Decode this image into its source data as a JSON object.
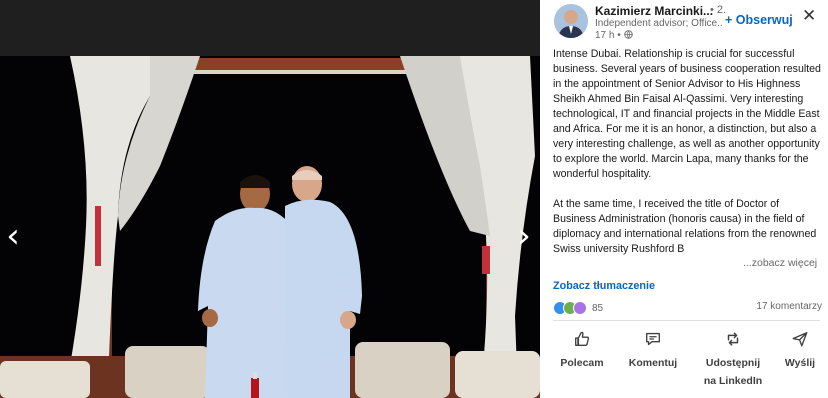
{
  "post": {
    "author": "Kazimierz Marcinki...",
    "degree": "• 2.",
    "subtitle": "Independent advisor; Office...",
    "time": "17 h •",
    "follow_label": "+ Obserwuj",
    "close_label": "✕",
    "body_p1": "Intense Dubai. Relationship is crucial for successful business. Several years of business cooperation resulted in the appointment of Senior Advisor to His Highness Sheikh Ahmed Bin Faisal Al-Qassimi. Very interesting technological, IT and financial projects in the Middle East and Africa. For me it is an honor, a distinction, but also a very interesting challenge, as well as another opportunity to explore the world. Marcin Lapa, many thanks for the wonderful hospitality.",
    "body_p2": "At the same time, I received the title of Doctor of Business Administration (honoris causa) in the field of diplomacy and international relations from the renowned Swiss university Rushford B",
    "see_more": "...zobacz więcej",
    "translate": "Zobacz tłumaczenie",
    "reactions_count": "85",
    "comments_count": "17 komentarzy"
  },
  "actions": {
    "like": "Polecam",
    "comment": "Komentuj",
    "share_line1": "Udostępnij",
    "share_line2": "na LinkedIn",
    "send": "Wyślij"
  },
  "viewer": {
    "prev_label": "‹",
    "next_label": "›"
  },
  "colors": {
    "accent": "#0a66c2",
    "like_reaction": "#378fe9",
    "support_reaction": "#6dae4f",
    "celebrate_reaction": "#a872e8"
  }
}
